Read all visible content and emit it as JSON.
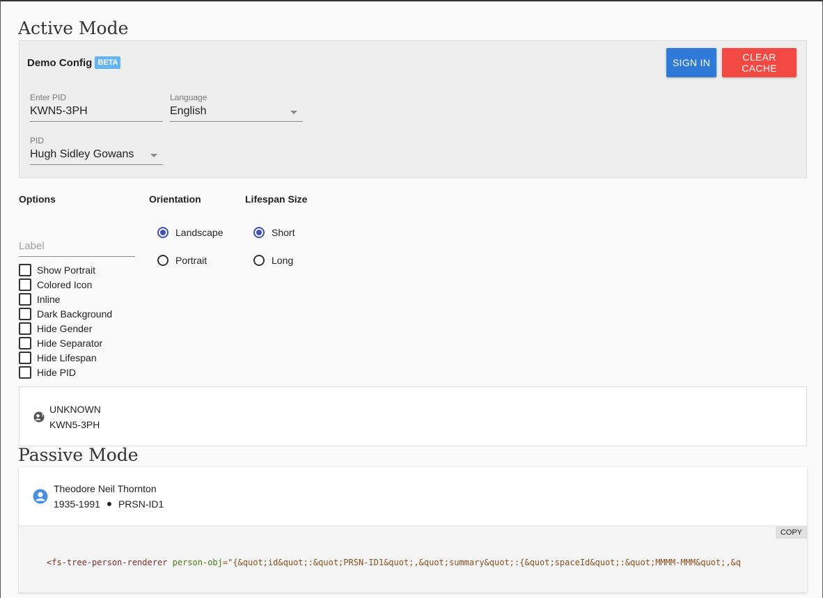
{
  "active": {
    "title": "Active Mode",
    "config": {
      "title": "Demo Config",
      "badge": "BETA",
      "sign_in_label": "SIGN IN",
      "clear_cache_label": "CLEAR CACHE",
      "pid_input": {
        "label": "Enter PID",
        "value": "KWN5-3PH"
      },
      "language": {
        "label": "Language",
        "value": "English"
      },
      "pid_select": {
        "label": "PID",
        "value": "Hugh Sidley Gowans"
      }
    },
    "options": {
      "heading": "Options",
      "label_placeholder": "Label",
      "checkboxes": [
        {
          "label": "Show Portrait",
          "checked": false
        },
        {
          "label": "Colored Icon",
          "checked": false
        },
        {
          "label": "Inline",
          "checked": false
        },
        {
          "label": "Dark Background",
          "checked": false
        },
        {
          "label": "Hide Gender",
          "checked": false
        },
        {
          "label": "Hide Separator",
          "checked": false
        },
        {
          "label": "Hide Lifespan",
          "checked": false
        },
        {
          "label": "Hide PID",
          "checked": false
        }
      ]
    },
    "orientation": {
      "heading": "Orientation",
      "choices": [
        {
          "label": "Landscape",
          "selected": true
        },
        {
          "label": "Portrait",
          "selected": false
        }
      ]
    },
    "lifespan": {
      "heading": "Lifespan Size",
      "choices": [
        {
          "label": "Short",
          "selected": true
        },
        {
          "label": "Long",
          "selected": false
        }
      ]
    },
    "preview": {
      "name": "UNKNOWN",
      "pid": "KWN5-3PH",
      "icon": "unknown-gender-person-icon"
    }
  },
  "passive": {
    "title": "Passive Mode",
    "person": {
      "name": "Theodore Neil Thornton",
      "lifespan": "1935-1991",
      "pid": "PRSN-ID1",
      "icon": "male-person-icon"
    },
    "copy_label": "COPY",
    "code": {
      "tag": "<fs-tree-person-renderer",
      "attr": "person-obj",
      "value": "=\"{&quot;id&quot;:&quot;PRSN-ID1&quot;,&quot;summary&quot;:{&quot;spaceId&quot;:&quot;MMMM-MMM&quot;,&q"
    }
  },
  "colors": {
    "sign_in": "#2f7ad8",
    "clear_cache": "#f44842",
    "beta_badge": "#64b5f6",
    "radio_selected": "#3f51b5",
    "person_icon_blue": "#4a90e2"
  }
}
